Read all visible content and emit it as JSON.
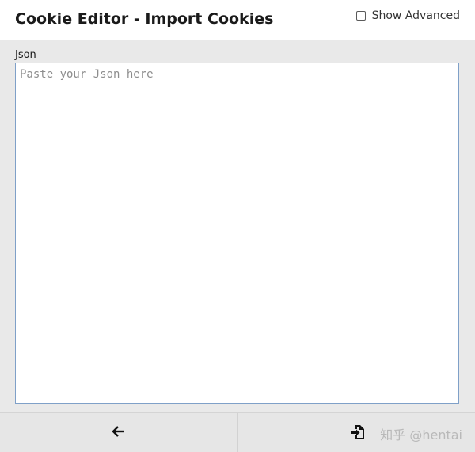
{
  "header": {
    "title": "Cookie Editor - Import Cookies",
    "advanced_label": "Show Advanced",
    "advanced_checked": false
  },
  "form": {
    "json_label": "Json",
    "json_value": "",
    "json_placeholder": "Paste your Json here"
  },
  "footer": {
    "back_icon": "arrow-left-icon",
    "import_icon": "file-import-icon",
    "watermark": "知乎 @hentai"
  },
  "colors": {
    "header_bg": "#ffffff",
    "body_bg": "#e9e9e9",
    "input_border": "#7fa0c8",
    "icon": "#111111"
  }
}
